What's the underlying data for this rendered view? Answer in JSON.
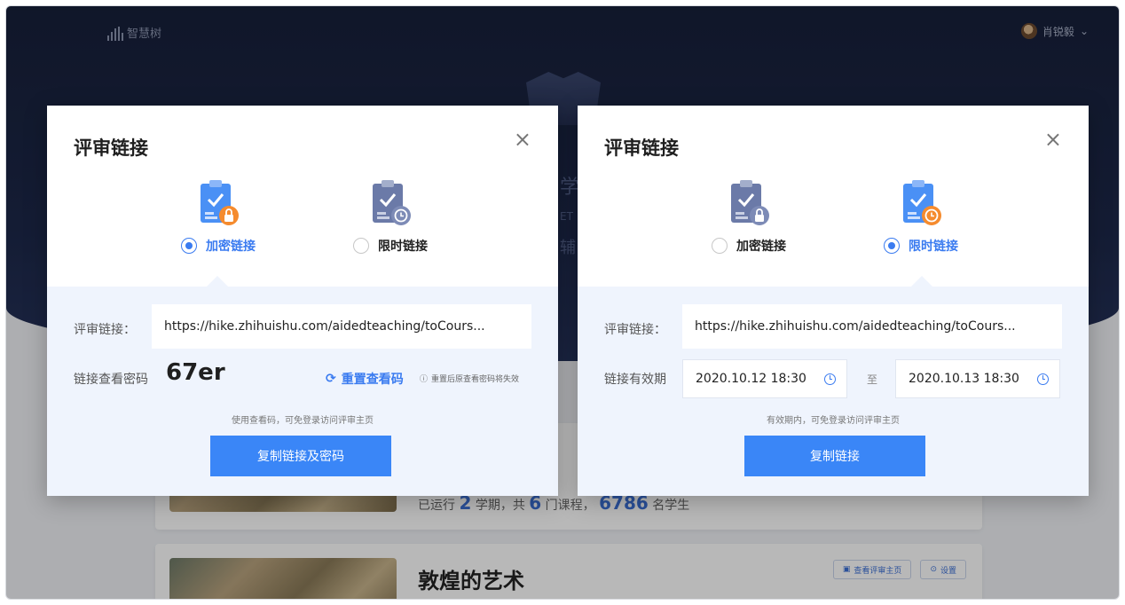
{
  "app": {
    "logo_text": "智慧树",
    "user_name": "肖锐毅"
  },
  "background": {
    "partial_text_1": "学",
    "partial_text_2": "ET",
    "partial_text_3": "辅",
    "card1_meta_prefix": "已运行",
    "card1_terms": "2",
    "card1_terms_unit": "学期，共",
    "card1_courses": "6",
    "card1_courses_unit": "门课程，",
    "card1_students": "6786",
    "card1_students_unit": "名学生",
    "card2_title": "敦煌的艺术",
    "card2_btn_view": "查看评审主页",
    "card2_btn_settings": "设置"
  },
  "modal_left": {
    "title": "评审链接",
    "close": "×",
    "option_encrypted": "加密链接",
    "option_timed": "限时链接",
    "selected": "encrypted",
    "link_label": "评审链接：",
    "link_value": "https://hike.zhihuishu.com/aidedteaching/toCours...",
    "password_label": "链接查看密码",
    "password_value": "67er",
    "reset_label": "重置查看码",
    "reset_warning": "重置后原查看密码将失效",
    "hint": "使用查看码，可免登录访问评审主页",
    "copy_button": "复制链接及密码"
  },
  "modal_right": {
    "title": "评审链接",
    "close": "×",
    "option_encrypted": "加密链接",
    "option_timed": "限时链接",
    "selected": "timed",
    "link_label": "评审链接：",
    "link_value": "https://hike.zhihuishu.com/aidedteaching/toCours...",
    "validity_label": "链接有效期",
    "start_date": "2020.10.12 18:30",
    "separator": "至",
    "end_date": "2020.10.13 18:30",
    "hint": "有效期内，可免登录访问评审主页",
    "copy_button": "复制链接"
  }
}
